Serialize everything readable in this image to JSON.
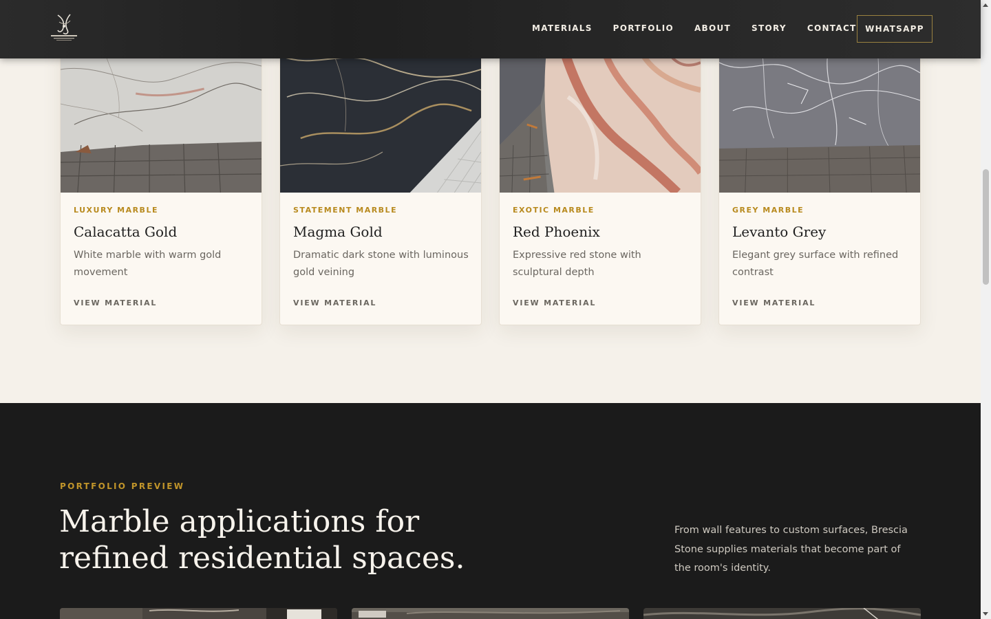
{
  "header": {
    "nav": [
      "MATERIALS",
      "PORTFOLIO",
      "ABOUT",
      "STORY",
      "CONTACT"
    ],
    "cta_label": "WHATSAPP"
  },
  "materials": {
    "cards": [
      {
        "category": "LUXURY MARBLE",
        "title": "Calacatta Gold",
        "description": "White marble with warm gold movement",
        "link_label": "VIEW MATERIAL"
      },
      {
        "category": "STATEMENT MARBLE",
        "title": "Magma Gold",
        "description": "Dramatic dark stone with luminous gold veining",
        "link_label": "VIEW MATERIAL"
      },
      {
        "category": "EXOTIC MARBLE",
        "title": "Red Phoenix",
        "description": "Expressive red stone with sculptural depth",
        "link_label": "VIEW MATERIAL"
      },
      {
        "category": "GREY MARBLE",
        "title": "Levanto Grey",
        "description": "Elegant grey surface with refined contrast",
        "link_label": "VIEW MATERIAL"
      }
    ]
  },
  "portfolio": {
    "eyebrow": "PORTFOLIO PREVIEW",
    "heading": "Marble applications for refined residential spaces.",
    "description": "From wall features to custom surfaces, Brescia Stone supplies materials that become part of the room's identity."
  },
  "colors": {
    "accent_gold": "#b88a1e",
    "eyebrow_gold": "#c1952a",
    "header_bg": "#262626",
    "page_bg": "#f5f1ea",
    "dark_section_bg": "#1b1b1b"
  }
}
